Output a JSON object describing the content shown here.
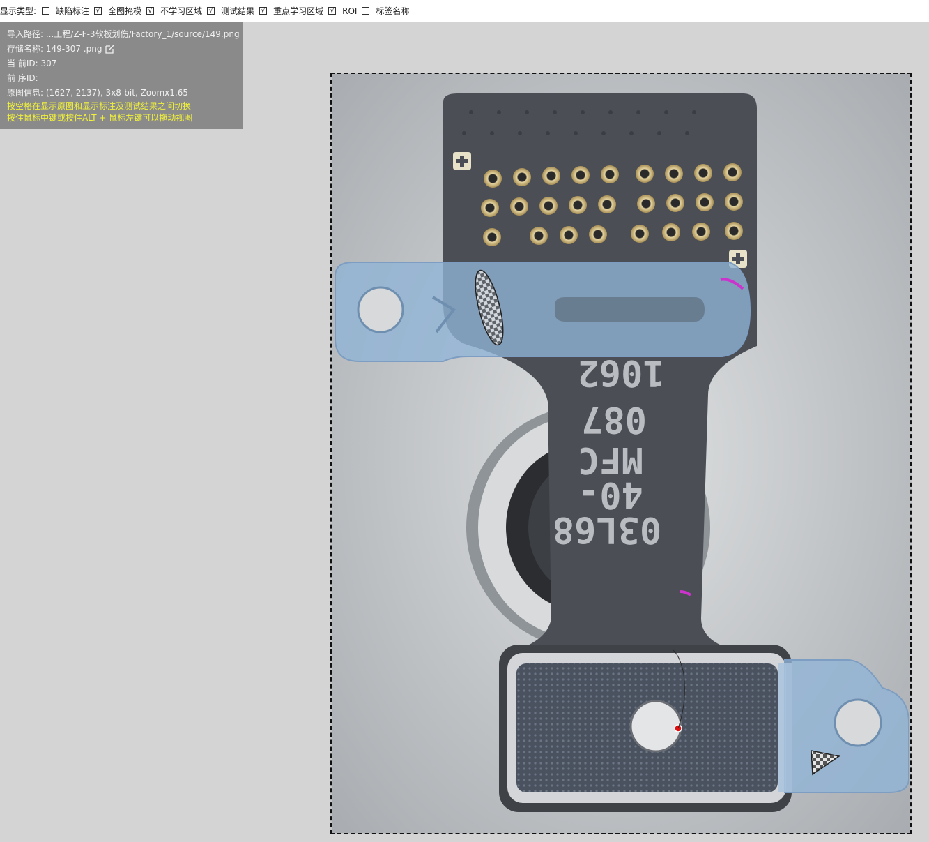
{
  "toolbar": {
    "label": "显示类型:",
    "options": [
      {
        "label": "缺陷标注",
        "checked": false
      },
      {
        "label": "全图掩模",
        "checked": true
      },
      {
        "label": "不学习区域",
        "checked": true
      },
      {
        "label": "测试结果",
        "checked": true
      },
      {
        "label": "重点学习区域",
        "checked": true
      },
      {
        "label": "ROI",
        "checked": true
      },
      {
        "label": "标签名称",
        "checked": false
      }
    ]
  },
  "info": {
    "import_path": "导入路径: ...工程/Z-F-3软板划伤/Factory_1/source/149.png",
    "save_name": "存储名称: 149-307  .png",
    "current_id": "当 前ID: 307",
    "prev_id": "前 序ID:",
    "image_info": "原图信息: (1627, 2137), 3x8-bit, Zoomx1.65",
    "hint_space": "按空格在显示原图和显示标注及测试结果之间切换",
    "hint_drag": "按住鼠标中键或按住ALT + 鼠标左键可以拖动视图"
  },
  "image": {
    "engraved_text": [
      "1062",
      "087",
      "MFC",
      "40-",
      "03L68"
    ],
    "colors": {
      "background": "#c3c7c9",
      "pcb": "#4b4e55",
      "gold_pad": "#c9b27a",
      "blue_mask": "#8fb3d6",
      "defect_magenta": "#cc33cc",
      "defect_red": "#e01010"
    }
  }
}
